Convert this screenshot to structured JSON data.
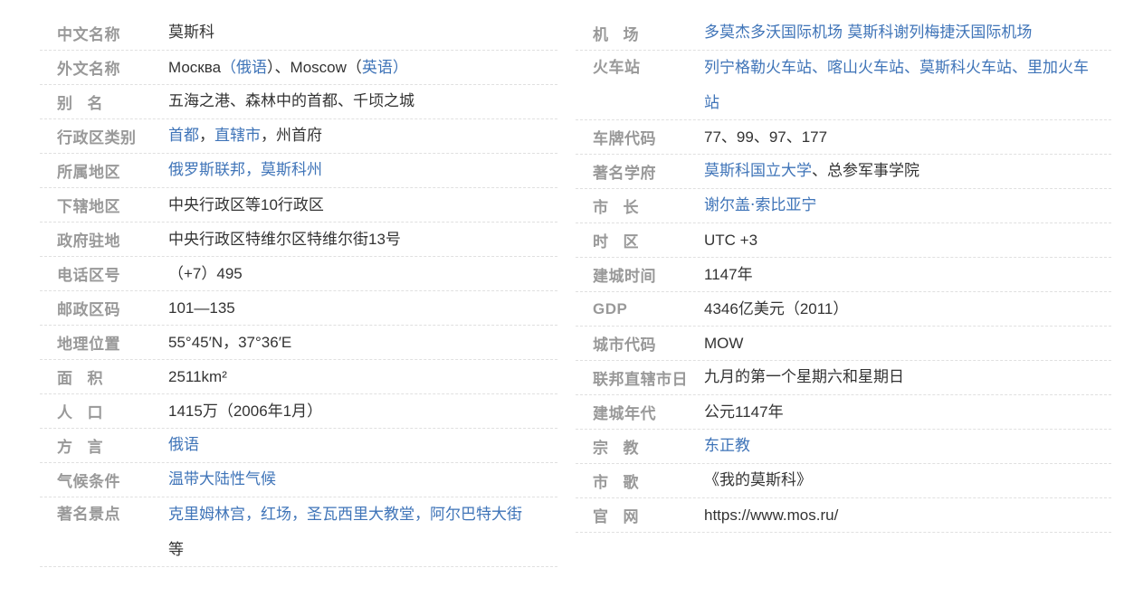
{
  "left": {
    "chinese_name": {
      "label": "中文名称",
      "value": "莫斯科"
    },
    "foreign_name": {
      "label": "外文名称",
      "v1": "Москва",
      "v2": "（",
      "v3": "俄语",
      "v4": "）、Moscow（",
      "v5": "英语",
      "v6": "）"
    },
    "alias": {
      "label_a": "别",
      "label_b": "名",
      "value": "五海之港、森林中的首都、千顷之城"
    },
    "admin_type": {
      "label": "行政区类别",
      "v1": "首都",
      "v2": "，",
      "v3": "直辖市",
      "v4": "，州首府"
    },
    "region": {
      "label": "所属地区",
      "v1": "俄罗斯联邦",
      "v2": "，",
      "v3": "莫斯科州"
    },
    "subdivisions": {
      "label": "下辖地区",
      "v1": "中央行政区等",
      "v2": "10",
      "v3": "行政区"
    },
    "government_seat": {
      "label": "政府驻地",
      "v1": "中央行政区特维尔区特维尔街",
      "v2": "13",
      "v3": "号"
    },
    "phone_code": {
      "label": "电话区号",
      "value": "（+7）495"
    },
    "postal_code": {
      "label": "邮政区码",
      "value": "101—135"
    },
    "location": {
      "label": "地理位置",
      "value": "55°45′N，37°36′E"
    },
    "area": {
      "label_a": "面",
      "label_b": "积",
      "value": "2511km²"
    },
    "population": {
      "label_a": "人",
      "label_b": "口",
      "v1": "1415",
      "v2": "万（",
      "v3": "2006",
      "v4": "年",
      "v5": "1",
      "v6": "月）"
    },
    "dialect": {
      "label_a": "方",
      "label_b": "言",
      "value": "俄语"
    },
    "climate": {
      "label": "气候条件",
      "value": "温带大陆性气候"
    },
    "landmarks": {
      "label": "著名景点",
      "v1": "克里姆林宫",
      "v2": "，",
      "v3": "红场",
      "v4": "，",
      "v5": "圣瓦西里大教堂",
      "v6": "，",
      "v7": "阿尔巴特大街",
      "v8": "等"
    }
  },
  "right": {
    "airport": {
      "label_a": "机",
      "label_b": "场",
      "v1": "多莫杰多沃国际机场",
      "v2": "莫斯科谢列梅捷沃国际机场"
    },
    "train_station": {
      "label": "火车站",
      "v1": "列宁格勒火车站",
      "v2": "、",
      "v3": "喀山火车站",
      "v4": "、",
      "v5": "莫斯科火车站",
      "v6": "、",
      "v7": "里加火车站"
    },
    "plate_code": {
      "label": "车牌代码",
      "value": "77、99、97、177"
    },
    "universities": {
      "label": "著名学府",
      "v1": "莫斯科国立大学",
      "v2": "、总参军事学院"
    },
    "mayor": {
      "label_a": "市",
      "label_b": "长",
      "value": "谢尔盖·索比亚宁"
    },
    "timezone": {
      "label_a": "时",
      "label_b": "区",
      "value": "UTC +3"
    },
    "founded_time": {
      "label": "建城时间",
      "v1": "1147",
      "v2": "年"
    },
    "gdp": {
      "label": "GDP",
      "v1": "4346",
      "v2": "亿美元（",
      "v3": "2011",
      "v4": "）"
    },
    "city_code": {
      "label": "城市代码",
      "value": "MOW"
    },
    "federal_day": {
      "label": "联邦直辖市日",
      "value": "九月的第一个星期六和星期日"
    },
    "founded_era": {
      "label": "建城年代",
      "v1": "公元",
      "v2": "1147",
      "v3": "年"
    },
    "religion": {
      "label_a": "宗",
      "label_b": "教",
      "value": "东正教"
    },
    "anthem": {
      "label_a": "市",
      "label_b": "歌",
      "value": "《我的莫斯科》"
    },
    "website": {
      "label_a": "官",
      "label_b": "网",
      "value": "https://www.mos.ru/"
    }
  },
  "colors": {
    "label": "#999999",
    "text": "#333333",
    "link": "#3f74b8",
    "divider": "#e0e0e0"
  }
}
